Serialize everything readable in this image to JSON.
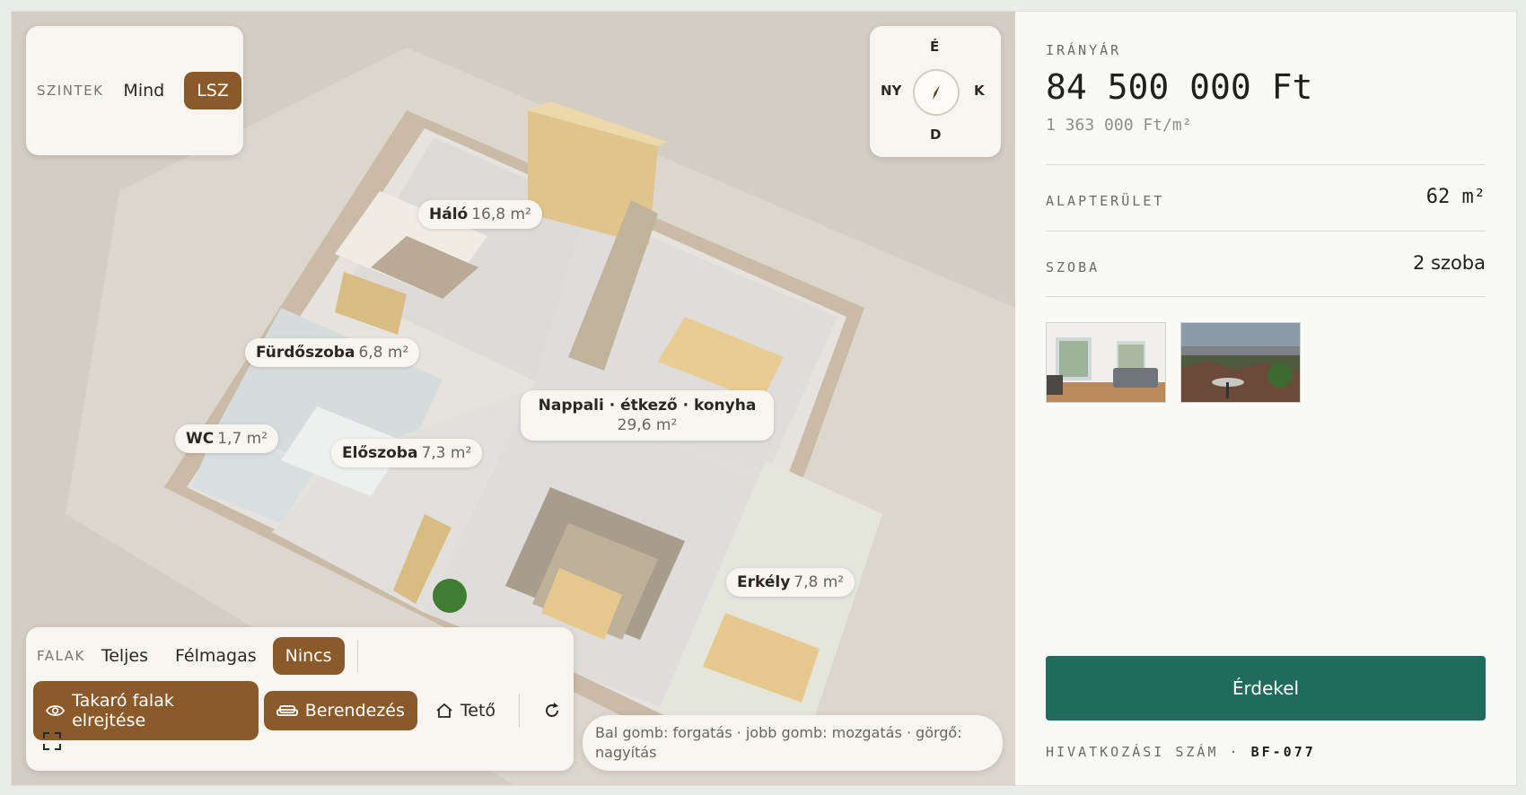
{
  "viewer": {
    "levels": {
      "caption": "SZINTEK",
      "options": [
        "Mind",
        "LSZ"
      ],
      "active": "LSZ"
    },
    "compass": {
      "n": "É",
      "s": "D",
      "w": "NY",
      "e": "K"
    },
    "rooms": [
      {
        "name": "Háló",
        "area": "16,8 m²"
      },
      {
        "name": "Fürdőszoba",
        "area": "6,8 m²"
      },
      {
        "name": "WC",
        "area": "1,7 m²"
      },
      {
        "name": "Előszoba",
        "area": "7,3 m²"
      },
      {
        "name": "Nappali · étkező · konyha",
        "area": "29,6 m²"
      },
      {
        "name": "Erkély",
        "area": "7,8 m²"
      }
    ],
    "walls": {
      "caption": "FALAK",
      "options": [
        "Teljes",
        "Félmagas",
        "Nincs"
      ],
      "active": "Nincs"
    },
    "toggles": {
      "hide_walls": "Takaró falak elrejtése",
      "furniture": "Berendezés",
      "roof": "Tető"
    },
    "hint": "Bal gomb: forgatás · jobb gomb: mozgatás · görgő: nagyítás"
  },
  "sidebar": {
    "price_caption": "IRÁNYÁR",
    "price": "84 500 000 Ft",
    "unit_price": "1 363 000 Ft/m²",
    "area_label": "ALAPTERÜLET",
    "area_value": "62 m²",
    "rooms_label": "SZOBA",
    "rooms_value": "2 szoba",
    "cta": "Érdekel",
    "ref_label": "HIVATKOZÁSI SZÁM ·",
    "ref_value": "BF-077"
  },
  "colors": {
    "accent": "#8a5a2b",
    "cta": "#1f6b5e"
  },
  "icons": [
    "compass-needle-icon",
    "eye-icon",
    "sofa-icon",
    "home-icon",
    "refresh-icon",
    "fullscreen-icon"
  ]
}
